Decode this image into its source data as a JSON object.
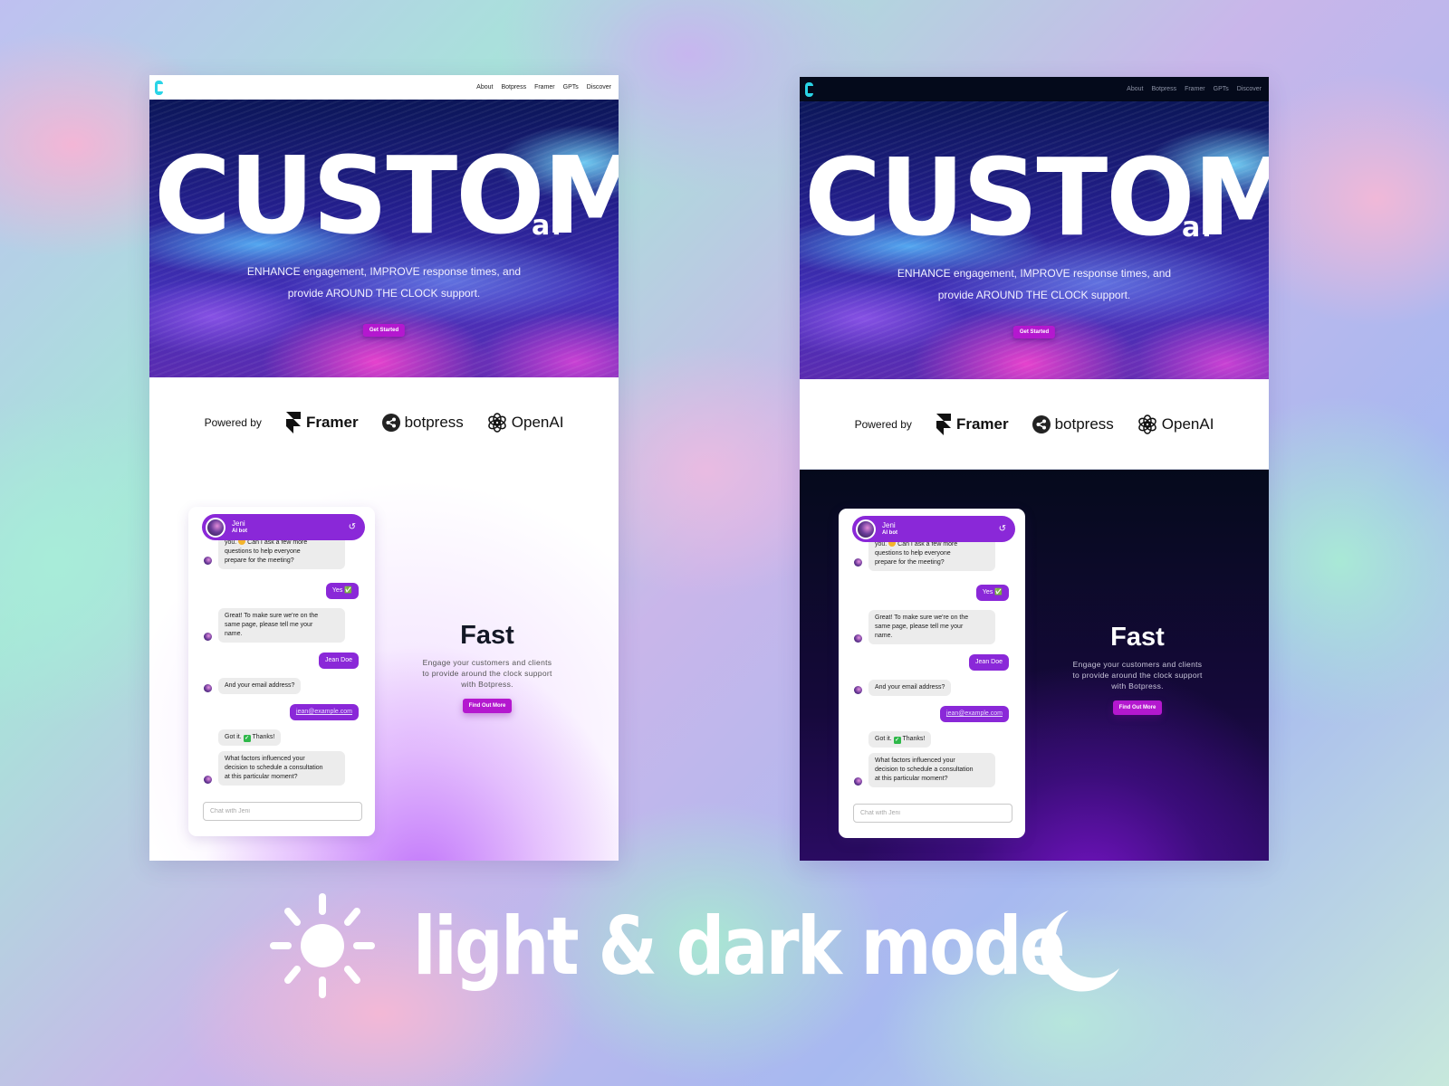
{
  "mockups": {
    "light": {
      "mode": "light"
    },
    "dark": {
      "mode": "dark"
    }
  },
  "nav": {
    "logo": "C",
    "links": [
      "About",
      "Botpress",
      "Framer",
      "GPTs",
      "Discover"
    ]
  },
  "hero": {
    "title": "CUSTOM",
    "title_suffix": "ai",
    "subtitle_line1": "ENHANCE engagement, IMPROVE response times, and",
    "subtitle_line2": "provide AROUND THE CLOCK support.",
    "cta_label": "Get Started"
  },
  "powered_by": {
    "label": "Powered by",
    "brands": [
      {
        "name": "Framer",
        "icon": "framer-logo-icon"
      },
      {
        "name": "botpress",
        "icon": "botpress-logo-icon"
      },
      {
        "name": "OpenAI",
        "icon": "openai-logo-icon"
      }
    ]
  },
  "chat": {
    "bot_name": "Jeni",
    "bot_role": "AI bot",
    "reset_icon": "↺",
    "messages": [
      {
        "from": "bot",
        "text": "you. Can I ask a few more questions to help everyone prepare for the meeting?",
        "line1_prefix": "you.",
        "line1_suffix": "Can I ask a few more",
        "line2": "questions to help everyone",
        "line3": "prepare for the meeting?"
      },
      {
        "from": "user",
        "text": "Yes ✅"
      },
      {
        "from": "bot",
        "text": "Great! To make sure we're on the same page, please tell me your name.",
        "line1": "Great! To make sure we're on the",
        "line2": "same page, please tell me your",
        "line3": "name."
      },
      {
        "from": "user",
        "text": "Jean Doe"
      },
      {
        "from": "bot",
        "text": "And your email address?"
      },
      {
        "from": "user",
        "text": "jean@example.com"
      },
      {
        "from": "bot",
        "text": "Got it. ✅ Thanks!",
        "prefix": "Got it.",
        "suffix": "Thanks!"
      },
      {
        "from": "bot",
        "text": "What factors influenced your decision to schedule a consultation at this particular moment?",
        "line1": "What factors influenced your",
        "line2": "decision to schedule a consultation",
        "line3": "at this particular moment?"
      }
    ],
    "input_placeholder": "Chat with Jeni"
  },
  "feature": {
    "title": "Fast",
    "description": "Engage your customers and clients to provide around the clock support with Botpress.",
    "cta_label": "Find Out More"
  },
  "tagline": {
    "text": "light & dark mode",
    "left_icon": "sun-icon",
    "right_icon": "moon-icon"
  },
  "colors": {
    "accent_purple": "#8a28d8",
    "cta_magenta": "#b418cf",
    "logo_cyan": "#2ad4e6",
    "dark_bg": "#050a1c"
  }
}
